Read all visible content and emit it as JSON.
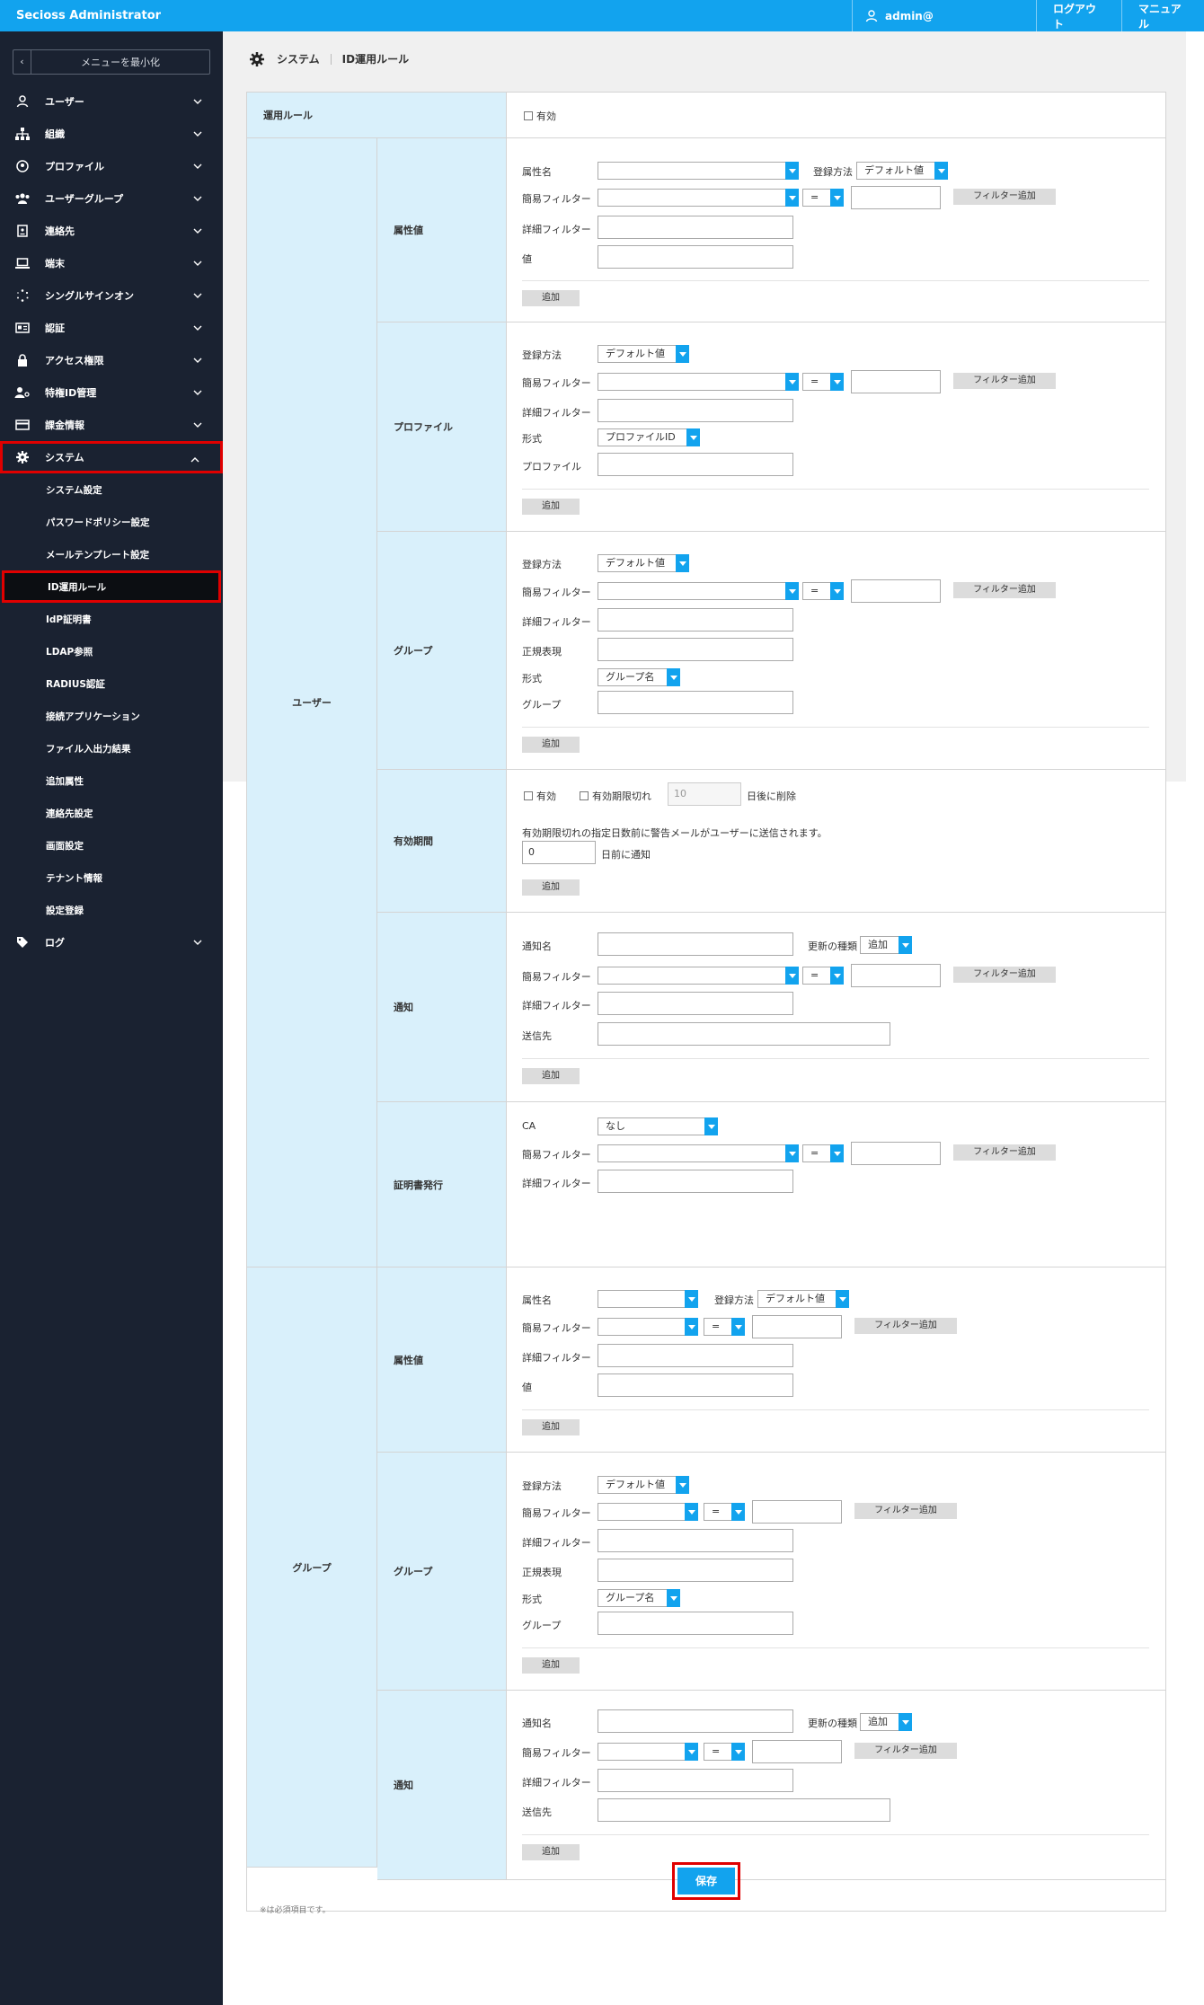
{
  "app": {
    "title": "Secioss Administrator",
    "user": "admin@",
    "logout": "ログアウト",
    "manual": "マニュアル"
  },
  "sidebar": {
    "collapse": "メニューを最小化",
    "items": [
      {
        "label": "ユーザー",
        "icon": "user-icon"
      },
      {
        "label": "組織",
        "icon": "org-icon"
      },
      {
        "label": "プロファイル",
        "icon": "profile-icon"
      },
      {
        "label": "ユーザーグループ",
        "icon": "users-icon"
      },
      {
        "label": "連絡先",
        "icon": "contact-icon"
      },
      {
        "label": "端末",
        "icon": "laptop-icon"
      },
      {
        "label": "シングルサインオン",
        "icon": "sso-icon"
      },
      {
        "label": "認証",
        "icon": "idcard-icon"
      },
      {
        "label": "アクセス権限",
        "icon": "lock-icon"
      },
      {
        "label": "特権ID管理",
        "icon": "user-key-icon"
      },
      {
        "label": "課金情報",
        "icon": "card-icon"
      },
      {
        "label": "システム",
        "icon": "gear-icon"
      }
    ],
    "sub": [
      "システム設定",
      "パスワードポリシー設定",
      "メールテンプレート設定",
      "ID運用ルール",
      "IdP証明書",
      "LDAP参照",
      "RADIUS認証",
      "接続アプリケーション",
      "ファイル入出力結果",
      "追加属性",
      "連絡先設定",
      "画面設定",
      "テナント情報",
      "設定登録"
    ],
    "log": "ログ"
  },
  "breadcrumb": {
    "section": "システム",
    "page": "ID運用ルール"
  },
  "rule": {
    "label": "運用ルール",
    "enabled": "有効"
  },
  "labels": {
    "user": "ユーザー",
    "group": "グループ",
    "attr_value": "属性値",
    "profile": "プロファイル",
    "group_sec": "グループ",
    "expiry": "有効期間",
    "notify": "通知",
    "cert": "証明書発行",
    "attr_name": "属性名",
    "reg_method": "登録方法",
    "simple_filter": "簡易フィルター",
    "detail_filter": "詳細フィルター",
    "value": "値",
    "format": "形式",
    "profile_field": "プロファイル",
    "regex": "正規表現",
    "group_field": "グループ",
    "notify_name": "通知名",
    "update_type": "更新の種類",
    "send_to": "送信先",
    "ca": "CA",
    "add": "追加",
    "add_filter": "フィルター追加",
    "enabled": "有効",
    "expired": "有効期限切れ",
    "delete_after": "日後に削除",
    "expiry_note": "有効期限切れの指定日数前に警告メールがユーザーに送信されます。",
    "days_before": "日前に通知",
    "required_note": "※は必須項目です。",
    "save": "保存"
  },
  "values": {
    "default_value": "デフォルト値",
    "eq": "=",
    "profile_id": "プロファイルID",
    "group_name": "グループ名",
    "add_opt": "追加",
    "none": "なし",
    "expire_days": "10",
    "notify_days": "0"
  }
}
